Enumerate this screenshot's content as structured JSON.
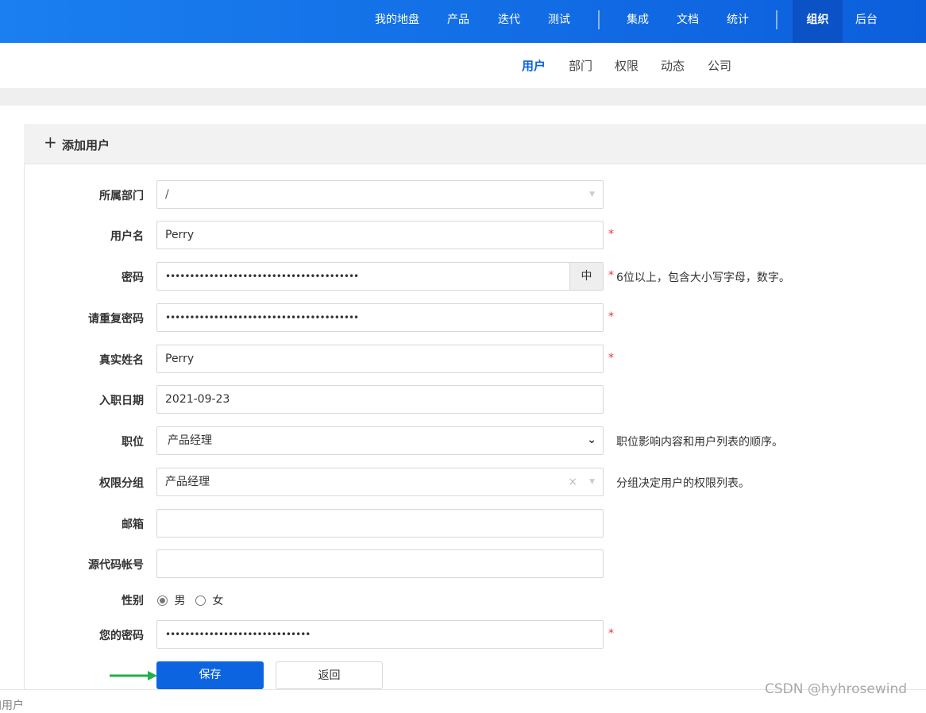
{
  "topnav": {
    "items": [
      "我的地盘",
      "产品",
      "迭代",
      "测试",
      "集成",
      "文档",
      "统计",
      "组织",
      "后台"
    ],
    "active": "组织"
  },
  "subnav": {
    "items": [
      "用户",
      "部门",
      "权限",
      "动态",
      "公司"
    ],
    "active": "用户"
  },
  "panel": {
    "title": "添加用户",
    "icon": "plus-icon"
  },
  "form": {
    "dept": {
      "label": "所属部门",
      "value": "/"
    },
    "account": {
      "label": "用户名",
      "value": "Perry"
    },
    "password": {
      "label": "密码",
      "value": "••••••••••••••••••••••••••••••••••••••••",
      "strength": "中",
      "hint": "6位以上，包含大小写字母，数字。"
    },
    "password2": {
      "label": "请重复密码",
      "value": "••••••••••••••••••••••••••••••••••••••••"
    },
    "realname": {
      "label": "真实姓名",
      "value": "Perry"
    },
    "join": {
      "label": "入职日期",
      "value": "2021-09-23"
    },
    "role": {
      "label": "职位",
      "value": "产品经理",
      "hint": "职位影响内容和用户列表的顺序。"
    },
    "group": {
      "label": "权限分组",
      "value": "产品经理",
      "hint": "分组决定用户的权限列表。"
    },
    "email": {
      "label": "邮箱",
      "value": ""
    },
    "commiter": {
      "label": "源代码帐号",
      "value": ""
    },
    "gender": {
      "label": "性别",
      "options": [
        "男",
        "女"
      ],
      "selected": "男"
    },
    "verify": {
      "label": "您的密码",
      "value": "••••••••••••••••••••••••••••••"
    },
    "required_mark": "*",
    "save": "保存",
    "back": "返回"
  },
  "footer_partial": "加用户",
  "watermark": "CSDN @hyhrosewind",
  "colors": {
    "accent": "#0c64e0",
    "required": "#e33333",
    "annotation_arrow": "#22b04a"
  }
}
